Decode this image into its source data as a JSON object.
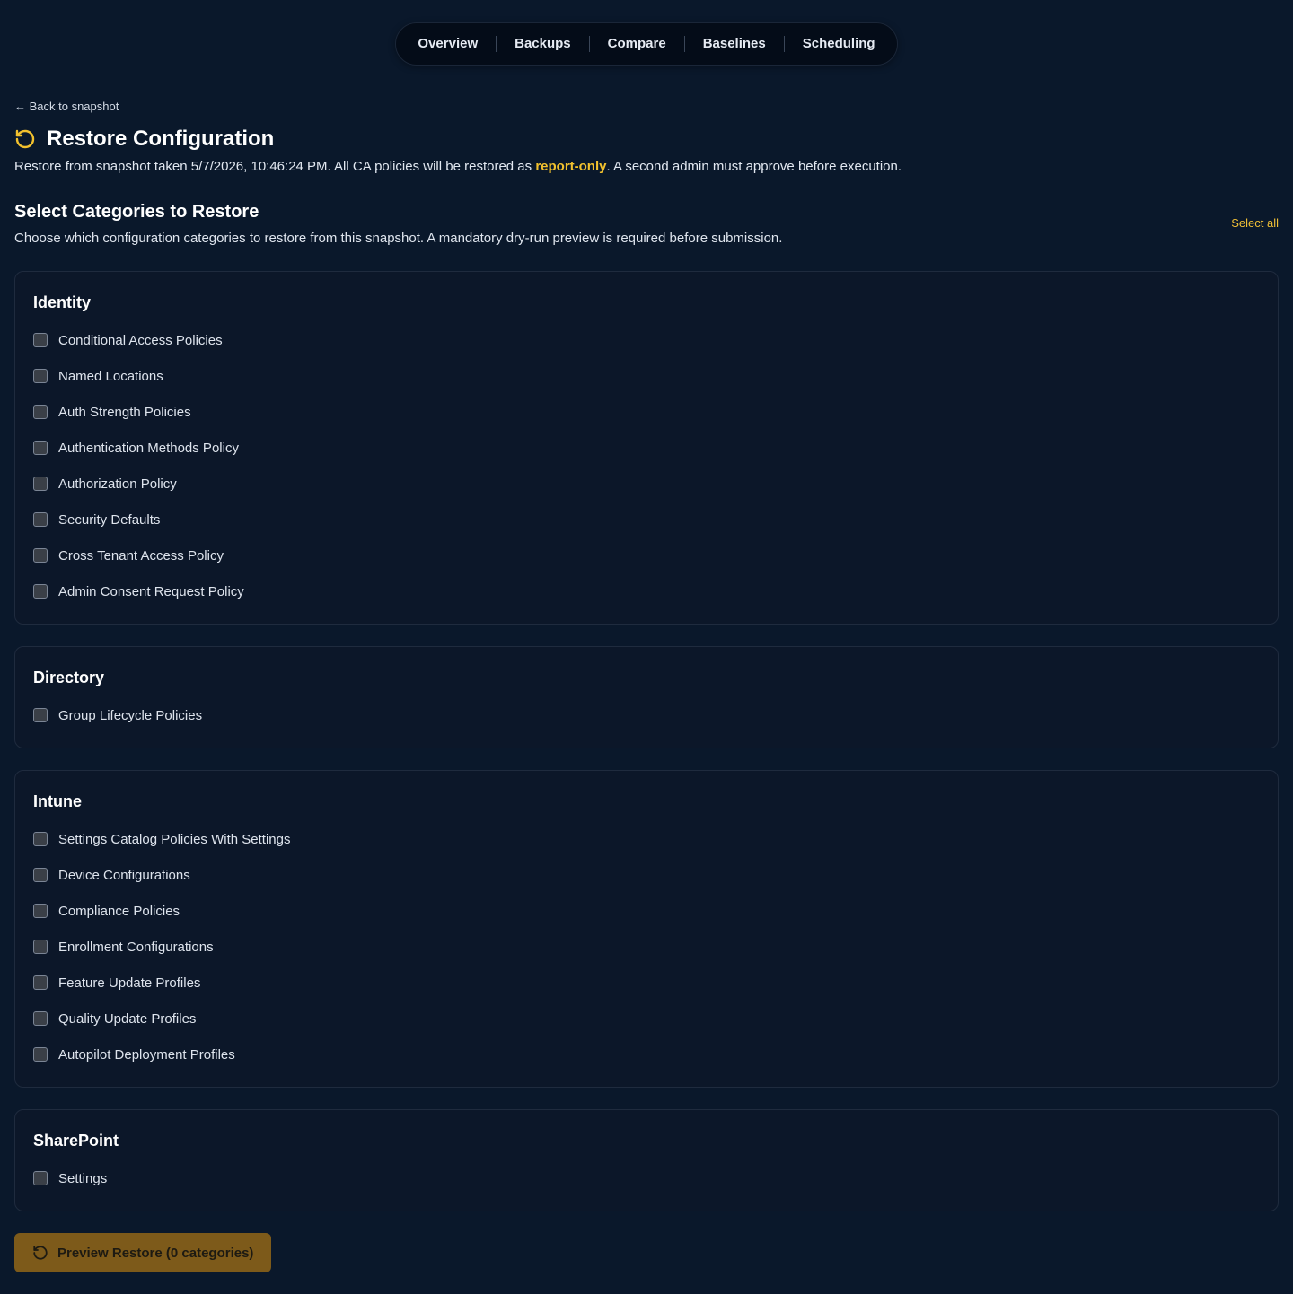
{
  "nav": {
    "tabs": [
      {
        "label": "Overview"
      },
      {
        "label": "Backups"
      },
      {
        "label": "Compare"
      },
      {
        "label": "Baselines"
      },
      {
        "label": "Scheduling"
      }
    ]
  },
  "header": {
    "back_link": "← Back to snapshot",
    "title": "Restore Configuration",
    "title_icon": "restore-icon",
    "subtitle_before": "Restore from snapshot taken 5/7/2026, 10:46:24 PM. All CA policies will be restored as ",
    "subtitle_highlight": "report-only",
    "subtitle_after": ". A second admin must approve before execution."
  },
  "selection": {
    "title": "Select Categories to Restore",
    "description": "Choose which configuration categories to restore from this snapshot. A mandatory dry-run preview is required before submission.",
    "select_all_label": "Select all"
  },
  "categories": [
    {
      "name": "Identity",
      "items": [
        {
          "label": "Conditional Access Policies",
          "checked": false
        },
        {
          "label": "Named Locations",
          "checked": false
        },
        {
          "label": "Auth Strength Policies",
          "checked": false
        },
        {
          "label": "Authentication Methods Policy",
          "checked": false
        },
        {
          "label": "Authorization Policy",
          "checked": false
        },
        {
          "label": "Security Defaults",
          "checked": false
        },
        {
          "label": "Cross Tenant Access Policy",
          "checked": false
        },
        {
          "label": "Admin Consent Request Policy",
          "checked": false
        }
      ]
    },
    {
      "name": "Directory",
      "items": [
        {
          "label": "Group Lifecycle Policies",
          "checked": false
        }
      ]
    },
    {
      "name": "Intune",
      "items": [
        {
          "label": "Settings Catalog Policies With Settings",
          "checked": false
        },
        {
          "label": "Device Configurations",
          "checked": false
        },
        {
          "label": "Compliance Policies",
          "checked": false
        },
        {
          "label": "Enrollment Configurations",
          "checked": false
        },
        {
          "label": "Feature Update Profiles",
          "checked": false
        },
        {
          "label": "Quality Update Profiles",
          "checked": false
        },
        {
          "label": "Autopilot Deployment Profiles",
          "checked": false
        }
      ]
    },
    {
      "name": "SharePoint",
      "items": [
        {
          "label": "Settings",
          "checked": false
        }
      ]
    }
  ],
  "actions": {
    "preview_label": "Preview Restore (0 categories)",
    "preview_icon": "restore-icon"
  },
  "colors": {
    "background": "#0a182b",
    "accent": "#f2c12e",
    "button_bg": "#7d5a1a"
  }
}
